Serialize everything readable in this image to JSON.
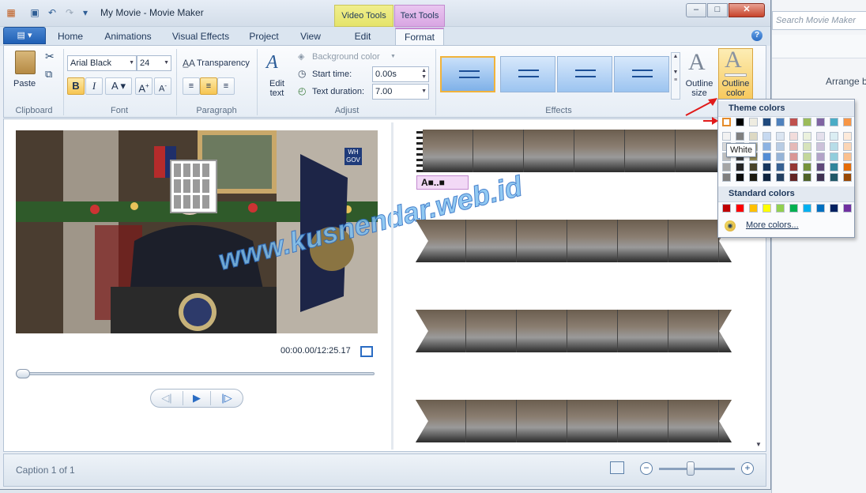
{
  "window": {
    "title": "My Movie - Movie Maker",
    "context_tabs": [
      "Video Tools",
      "Text Tools"
    ],
    "controls": {
      "minimize": "–",
      "maximize": "□",
      "close": "✕"
    }
  },
  "background_window": {
    "search_placeholder": "Search Movie Maker",
    "arrange_label": "Arrange b"
  },
  "tabs": [
    "Home",
    "Animations",
    "Visual Effects",
    "Project",
    "View",
    "Edit",
    "Format"
  ],
  "active_tab": "Format",
  "ribbon": {
    "clipboard": {
      "paste": "Paste",
      "group": "Clipboard"
    },
    "font": {
      "family": "Arial Black",
      "size": "24",
      "group": "Font"
    },
    "paragraph": {
      "transparency": "Transparency",
      "group": "Paragraph"
    },
    "adjust": {
      "edit_text": "Edit\ntext",
      "background_color": "Background color",
      "start_time_label": "Start time:",
      "start_time_value": "0.00s",
      "duration_label": "Text duration:",
      "duration_value": "7.00",
      "group": "Adjust"
    },
    "effects": {
      "group": "Effects",
      "outline_size": "Outline\nsize",
      "outline_color": "Outline\ncolor"
    }
  },
  "preview": {
    "timecode": "00:00.00/12:25.17"
  },
  "timeline": {
    "caption_chip": "A■..■"
  },
  "status": {
    "caption": "Caption 1 of 1"
  },
  "color_menu": {
    "theme_header": "Theme colors",
    "standard_header": "Standard colors",
    "tooltip": "White",
    "more_colors": "More colors...",
    "theme_top": [
      "#ffffff",
      "#000000",
      "#eeece1",
      "#1f497d",
      "#4f81bd",
      "#c0504d",
      "#9bbb59",
      "#8064a2",
      "#4bacc6",
      "#f79646"
    ],
    "theme_shades": [
      [
        "#f2f2f2",
        "#7f7f7f",
        "#ddd9c3",
        "#c6d9f0",
        "#dbe5f1",
        "#f2dcdb",
        "#ebf1dd",
        "#e5e0ec",
        "#dbeef3",
        "#fdeada"
      ],
      [
        "#d8d8d8",
        "#595959",
        "#c4bd97",
        "#8db3e2",
        "#b8cce4",
        "#e5b9b7",
        "#d7e3bc",
        "#ccc1d9",
        "#b7dde8",
        "#fbd5b5"
      ],
      [
        "#bfbfbf",
        "#3f3f3f",
        "#938953",
        "#548dd4",
        "#95b3d7",
        "#d99694",
        "#c3d69b",
        "#b2a2c7",
        "#92cddc",
        "#fac08f"
      ],
      [
        "#a5a5a5",
        "#262626",
        "#494429",
        "#17365d",
        "#366092",
        "#953734",
        "#76923c",
        "#5f497a",
        "#31859b",
        "#e36c09"
      ],
      [
        "#7f7f7f",
        "#0c0c0c",
        "#1d1b10",
        "#0f243e",
        "#244061",
        "#632423",
        "#4f6128",
        "#3f3151",
        "#205867",
        "#974806"
      ]
    ],
    "standard": [
      "#c00000",
      "#ff0000",
      "#ffc000",
      "#ffff00",
      "#92d050",
      "#00b050",
      "#00b0f0",
      "#0070c0",
      "#002060",
      "#7030a0"
    ]
  },
  "watermark": "www.kusnendar.web.id"
}
